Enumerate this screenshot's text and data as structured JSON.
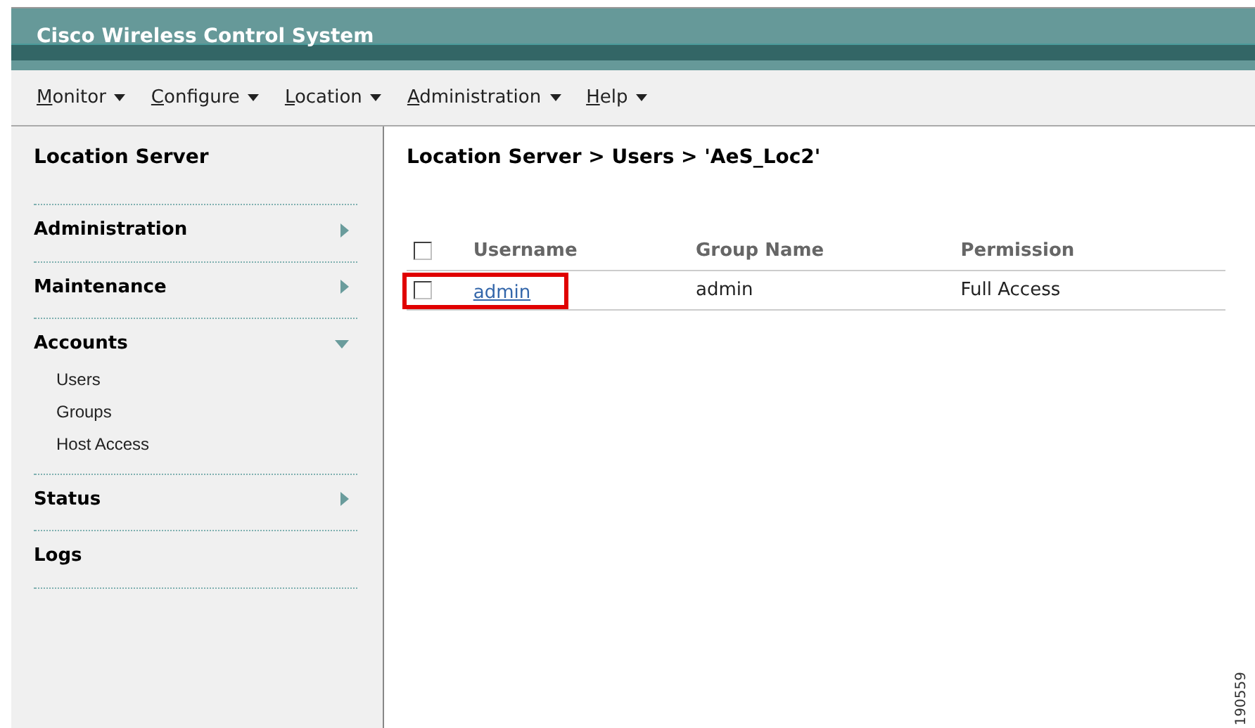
{
  "window": {
    "title": "Cisco Wireless Control System"
  },
  "menu": [
    {
      "label": "Monitor"
    },
    {
      "label": "Configure"
    },
    {
      "label": "Location"
    },
    {
      "label": "Administration"
    },
    {
      "label": "Help"
    }
  ],
  "sidebar": {
    "title": "Location Server",
    "items": [
      {
        "label": "Administration",
        "kind": "submenu",
        "expanded": false
      },
      {
        "label": "Maintenance",
        "kind": "submenu",
        "expanded": false
      },
      {
        "label": "Accounts",
        "kind": "submenu",
        "expanded": true,
        "children": [
          {
            "label": "Users"
          },
          {
            "label": "Groups"
          },
          {
            "label": "Host Access"
          }
        ]
      },
      {
        "label": "Status",
        "kind": "submenu",
        "expanded": false
      },
      {
        "label": "Logs",
        "kind": "link"
      }
    ]
  },
  "breadcrumb": "Location Server > Users > 'AeS_Loc2'",
  "table": {
    "select_all": {
      "checked": false
    },
    "columns": [
      "Username",
      "Group Name",
      "Permission"
    ],
    "rows": [
      {
        "checked": false,
        "highlighted": true,
        "cells": [
          "admin",
          "admin",
          "Full Access"
        ]
      }
    ]
  },
  "figure_id": "190559"
}
